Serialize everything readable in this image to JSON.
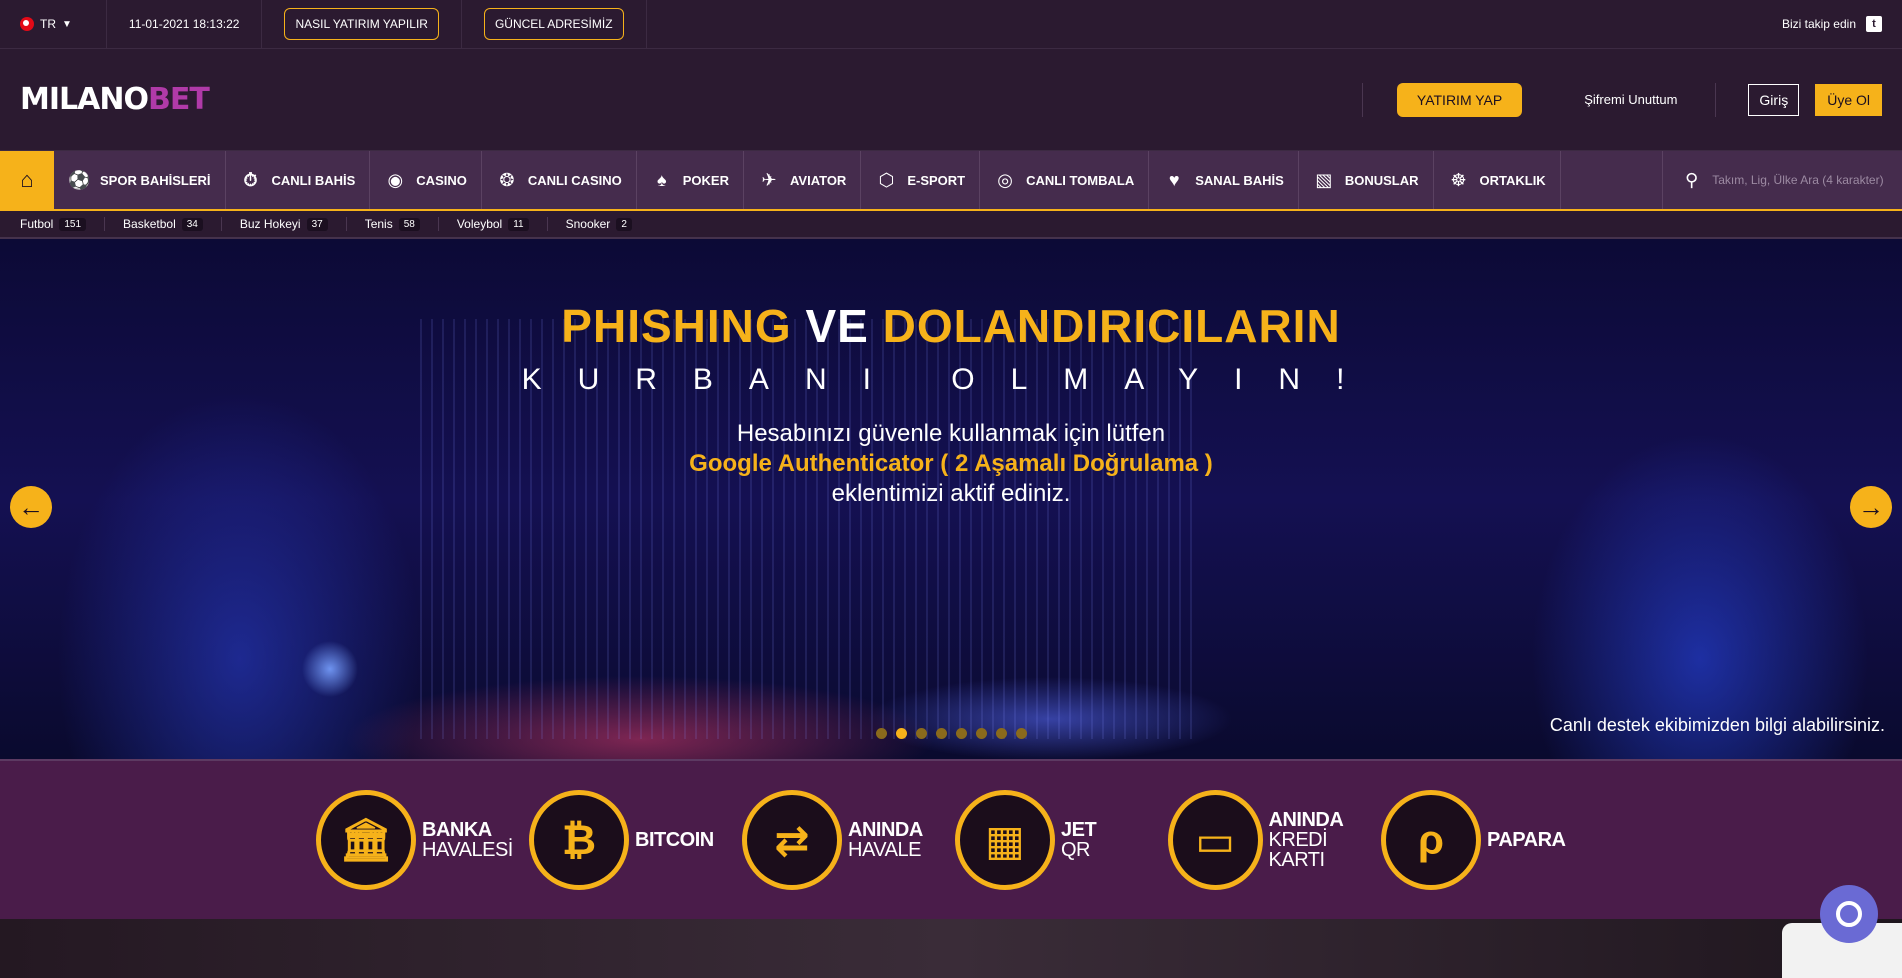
{
  "topbar": {
    "lang": "TR",
    "datetime": "11-01-2021 18:13:22",
    "btn_how": "NASIL YATIRIM YAPILIR",
    "btn_address": "GÜNCEL ADRESİMİZ",
    "follow": "Bizi takip edin"
  },
  "header": {
    "logo_main": "MILANO",
    "logo_accent": "BET",
    "deposit": "YATIRIM YAP",
    "forgot": "Şifremi Unuttum",
    "login": "Giriş",
    "signup": "Üye Ol"
  },
  "nav": {
    "items": [
      {
        "label": "SPOR BAHİSLERİ",
        "icon": "soccer-ball-icon"
      },
      {
        "label": "CANLI BAHİS",
        "icon": "stopwatch-icon"
      },
      {
        "label": "CASINO",
        "icon": "gamepad-icon"
      },
      {
        "label": "CANLI CASINO",
        "icon": "poker-chip-icon"
      },
      {
        "label": "POKER",
        "icon": "cards-icon"
      },
      {
        "label": "AVIATOR",
        "icon": "plane-icon"
      },
      {
        "label": "E-SPORT",
        "icon": "esport-icon"
      },
      {
        "label": "CANLI TOMBALA",
        "icon": "tombala-icon"
      },
      {
        "label": "SANAL BAHİS",
        "icon": "heart-icon"
      },
      {
        "label": "BONUSLAR",
        "icon": "gift-icon"
      },
      {
        "label": "ORTAKLIK",
        "icon": "handshake-icon"
      }
    ],
    "search_placeholder": "Takım, Lig, Ülke Ara (4 karakter)"
  },
  "sports": [
    {
      "name": "Futbol",
      "count": "151"
    },
    {
      "name": "Basketbol",
      "count": "34"
    },
    {
      "name": "Buz Hokeyi",
      "count": "37"
    },
    {
      "name": "Tenis",
      "count": "58"
    },
    {
      "name": "Voleybol",
      "count": "11"
    },
    {
      "name": "Snooker",
      "count": "2"
    }
  ],
  "hero": {
    "title_a": "PHISHING",
    "title_b": "VE",
    "title_c": "DOLANDIRICILARIN",
    "subtitle": "KURBANI OLMAYIN!",
    "line1": "Hesabınızı güvenle kullanmak için lütfen",
    "line2": "Google Authenticator ( 2 Aşamalı Doğrulama )",
    "line3": "eklentimizi aktif ediniz.",
    "support": "Canlı destek ekibimizden bilgi alabilirsiniz.",
    "slides": 8,
    "active_slide": 2
  },
  "payments": [
    {
      "line1": "BANKA",
      "line2": "HAVALESİ",
      "icon": "bank-icon",
      "glyph": "🏛"
    },
    {
      "line1": "BITCOIN",
      "line2": "",
      "icon": "bitcoin-icon",
      "glyph": "₿"
    },
    {
      "line1": "ANINDA",
      "line2": "HAVALE",
      "icon": "transfer-icon",
      "glyph": "⇄"
    },
    {
      "line1": "JET",
      "line2": "QR",
      "icon": "qr-code-icon",
      "glyph": "▦"
    },
    {
      "line1": "ANINDA",
      "line2": "KREDİ KARTI",
      "icon": "credit-card-icon",
      "glyph": "▭"
    },
    {
      "line1": "PAPARA",
      "line2": "",
      "icon": "papara-icon",
      "glyph": "ρ"
    }
  ],
  "colors": {
    "accent": "#f6b21a",
    "background": "#2b1a30",
    "nav": "#452c4d",
    "payments_bg": "#4a1c4a"
  }
}
